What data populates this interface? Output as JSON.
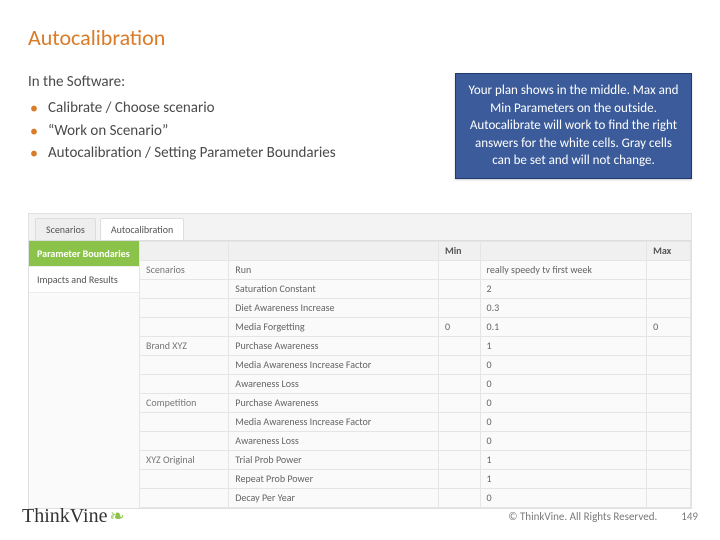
{
  "title": "Autocalibration",
  "intro": "In the Software:",
  "bullets": [
    "Calibrate / Choose scenario",
    "“Work on Scenario”",
    "Autocalibration / Setting Parameter Boundaries"
  ],
  "callout": "Your plan shows in the middle. Max and Min Parameters on the outside. Autocalibrate will work to find the right answers for the white cells. Gray cells can be set and will not change.",
  "app": {
    "tabs": [
      "Scenarios",
      "Autocalibration"
    ],
    "active_tab": "Autocalibration",
    "side": [
      "Parameter Boundaries",
      "Impacts and Results"
    ],
    "active_side": "Parameter Boundaries",
    "headers": [
      "",
      "",
      "Min",
      "",
      "Max"
    ],
    "rows": [
      {
        "group": "Scenarios",
        "label": "Run",
        "min": "",
        "val": "really speedy tv first week",
        "max": ""
      },
      {
        "group": "",
        "label": "Saturation Constant",
        "min": "",
        "val": "2",
        "max": ""
      },
      {
        "group": "",
        "label": "Diet Awareness Increase",
        "min": "",
        "val": "0.3",
        "max": ""
      },
      {
        "group": "",
        "label": "Media Forgetting",
        "min": "0",
        "val": "0.1",
        "max": "0"
      },
      {
        "group": "Brand XYZ",
        "label": "Purchase Awareness",
        "min": "",
        "val": "1",
        "max": ""
      },
      {
        "group": "",
        "label": "Media Awareness Increase Factor",
        "min": "",
        "val": "0",
        "max": ""
      },
      {
        "group": "",
        "label": "Awareness Loss",
        "min": "",
        "val": "0",
        "max": ""
      },
      {
        "group": "Competition",
        "label": "Purchase Awareness",
        "min": "",
        "val": "0",
        "max": ""
      },
      {
        "group": "",
        "label": "Media Awareness Increase Factor",
        "min": "",
        "val": "0",
        "max": ""
      },
      {
        "group": "",
        "label": "Awareness Loss",
        "min": "",
        "val": "0",
        "max": ""
      },
      {
        "group": "XYZ Original",
        "label": "Trial Prob Power",
        "min": "",
        "val": "1",
        "max": ""
      },
      {
        "group": "",
        "label": "Repeat Prob Power",
        "min": "",
        "val": "1",
        "max": ""
      },
      {
        "group": "",
        "label": "Decay Per Year",
        "min": "",
        "val": "0",
        "max": ""
      }
    ]
  },
  "footer": {
    "logo_text": "ThinkVine",
    "copyright": "© ThinkVine.  All Rights Reserved.",
    "page": "149"
  }
}
